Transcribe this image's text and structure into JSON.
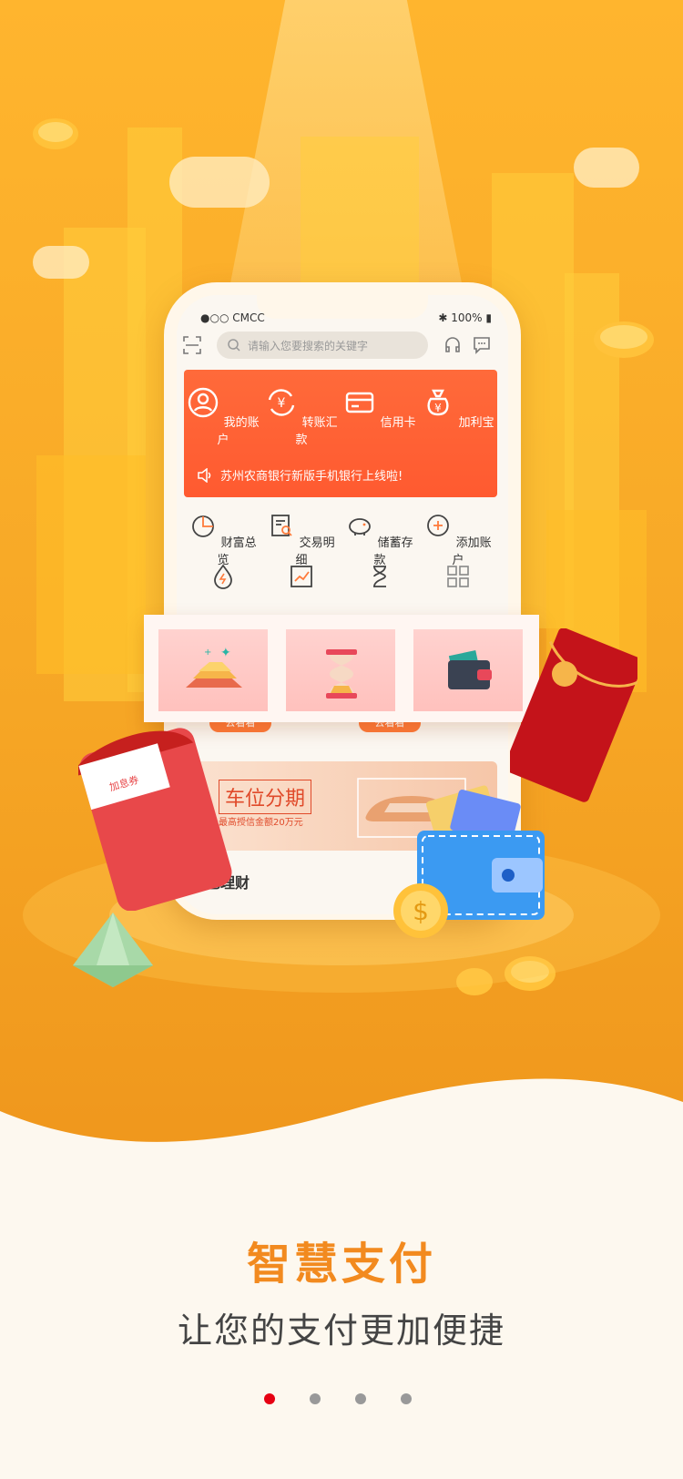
{
  "phone": {
    "carrier": "CMCC",
    "battery": "100%",
    "search_placeholder": "请输入您要搜索的关键字",
    "quick_actions": [
      {
        "label": "我的账户",
        "icon": "user-icon"
      },
      {
        "label": "转账汇款",
        "icon": "transfer-icon"
      },
      {
        "label": "信用卡",
        "icon": "card-icon"
      },
      {
        "label": "加利宝",
        "icon": "money-bag-icon"
      }
    ],
    "notice": "苏州农商银行新版手机银行上线啦!",
    "functions": [
      {
        "label": "财富总览",
        "icon": "pie-chart-icon"
      },
      {
        "label": "交易明细",
        "icon": "receipt-search-icon"
      },
      {
        "label": "储蓄存款",
        "icon": "piggy-bank-icon"
      },
      {
        "label": "添加账户",
        "icon": "plus-circle-icon"
      }
    ],
    "functions_row2_icons": [
      "bolt-drop-icon",
      "trend-chart-icon",
      "hourglass-icon",
      "grid-icon"
    ],
    "go_buttons": [
      "去看看",
      "去看看"
    ],
    "promo": {
      "title": "车位分期",
      "subtitle": "最高授信金额20万元"
    },
    "section_title": "特色理财",
    "envelope_label": "加息券"
  },
  "intro": {
    "title": "智慧支付",
    "subtitle": "让您的支付更加便捷"
  },
  "pager": {
    "count": 4,
    "active_index": 0
  },
  "colors": {
    "bg_orange": "#f7a826",
    "accent_orange": "#f28a1f",
    "card_red": "#ff5a30",
    "dot_active": "#e60012",
    "dot_inactive": "#999999"
  }
}
